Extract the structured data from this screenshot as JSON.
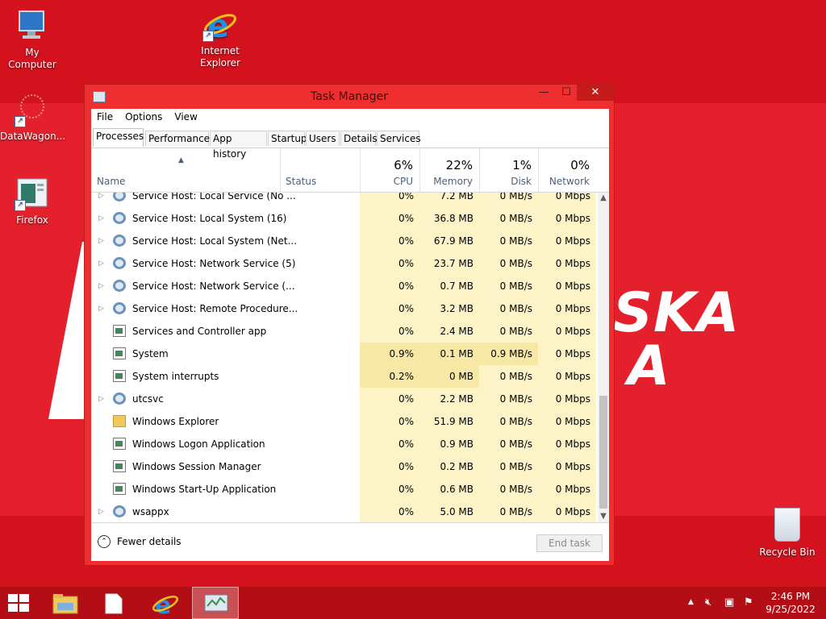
{
  "desktop": {
    "icons": [
      {
        "label": "My Computer",
        "icon": "computer-icon"
      },
      {
        "label": "Internet Explorer",
        "icon": "ie-icon"
      },
      {
        "label": "DataWagon...",
        "icon": "datawagon-icon"
      },
      {
        "label": "Firefox",
        "icon": "firefox-icon"
      },
      {
        "label": "Recycle Bin",
        "icon": "recycle-bin-icon"
      }
    ],
    "wallpaper_text": [
      "SKA",
      "A"
    ]
  },
  "task_manager": {
    "title": "Task Manager",
    "menu": [
      "File",
      "Options",
      "View"
    ],
    "tabs": [
      "Processes",
      "Performance",
      "App history",
      "Startup",
      "Users",
      "Details",
      "Services"
    ],
    "columns": {
      "name": "Name",
      "status": "Status",
      "cpu": {
        "pct": "6%",
        "label": "CPU"
      },
      "memory": {
        "pct": "22%",
        "label": "Memory"
      },
      "disk": {
        "pct": "1%",
        "label": "Disk"
      },
      "network": {
        "pct": "0%",
        "label": "Network"
      }
    },
    "rows": [
      {
        "name": "Service Host: Local Service (No ...",
        "cpu": "0%",
        "memory": "7.2 MB",
        "disk": "0 MB/s",
        "network": "0 Mbps"
      },
      {
        "name": "Service Host: Local System (16)",
        "cpu": "0%",
        "memory": "36.8 MB",
        "disk": "0 MB/s",
        "network": "0 Mbps"
      },
      {
        "name": "Service Host: Local System (Net...",
        "cpu": "0%",
        "memory": "67.9 MB",
        "disk": "0 MB/s",
        "network": "0 Mbps"
      },
      {
        "name": "Service Host: Network Service (5)",
        "cpu": "0%",
        "memory": "23.7 MB",
        "disk": "0 MB/s",
        "network": "0 Mbps"
      },
      {
        "name": "Service Host: Network Service (...",
        "cpu": "0%",
        "memory": "0.7 MB",
        "disk": "0 MB/s",
        "network": "0 Mbps"
      },
      {
        "name": "Service Host: Remote Procedure...",
        "cpu": "0%",
        "memory": "3.2 MB",
        "disk": "0 MB/s",
        "network": "0 Mbps"
      },
      {
        "name": "Services and Controller app",
        "cpu": "0%",
        "memory": "2.4 MB",
        "disk": "0 MB/s",
        "network": "0 Mbps"
      },
      {
        "name": "System",
        "cpu": "0.9%",
        "memory": "0.1 MB",
        "disk": "0.9 MB/s",
        "network": "0 Mbps"
      },
      {
        "name": "System interrupts",
        "cpu": "0.2%",
        "memory": "0 MB",
        "disk": "0 MB/s",
        "network": "0 Mbps"
      },
      {
        "name": "utcsvc",
        "cpu": "0%",
        "memory": "2.2 MB",
        "disk": "0 MB/s",
        "network": "0 Mbps"
      },
      {
        "name": "Windows Explorer",
        "cpu": "0%",
        "memory": "51.9 MB",
        "disk": "0 MB/s",
        "network": "0 Mbps"
      },
      {
        "name": "Windows Logon Application",
        "cpu": "0%",
        "memory": "0.9 MB",
        "disk": "0 MB/s",
        "network": "0 Mbps"
      },
      {
        "name": "Windows Session Manager",
        "cpu": "0%",
        "memory": "0.2 MB",
        "disk": "0 MB/s",
        "network": "0 Mbps"
      },
      {
        "name": "Windows Start-Up Application",
        "cpu": "0%",
        "memory": "0.6 MB",
        "disk": "0 MB/s",
        "network": "0 Mbps"
      },
      {
        "name": "wsappx",
        "cpu": "0%",
        "memory": "5.0 MB",
        "disk": "0 MB/s",
        "network": "0 Mbps"
      }
    ],
    "footer": {
      "fewer_details": "Fewer details",
      "end_task": "End task"
    }
  },
  "taskbar": {
    "time": "2:46 PM",
    "date": "9/25/2022"
  },
  "colors": {
    "desktop_bg": "#d4121e",
    "window_frame": "#ef2f2f",
    "taskbar": "#b30e15"
  }
}
